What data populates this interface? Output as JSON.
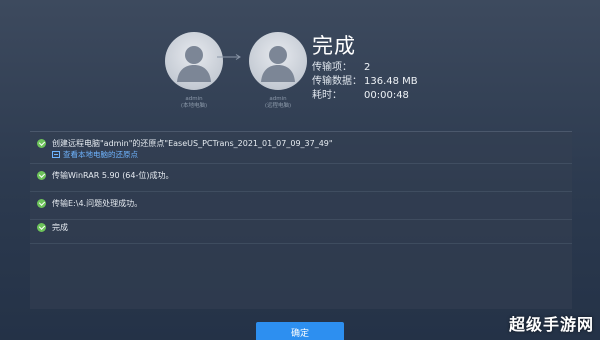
{
  "local_pc": {
    "user": "admin",
    "role": "(本地电脑)"
  },
  "remote_pc": {
    "user": "admin",
    "role": "(远程电脑)"
  },
  "status": {
    "title": "完成",
    "items_label": "传输项：",
    "items_value": "2",
    "data_label": "传输数据：",
    "data_value": "136.48 MB",
    "time_label": "耗时：",
    "time_value": "00:00:48"
  },
  "log": [
    {
      "text": "创建远程电脑\"admin\"的还原点\"EaseUS_PCTrans_2021_01_07_09_37_49\"",
      "link": "查看本地电脑的还原点"
    },
    {
      "text": "传输WinRAR 5.90 (64-位)成功。"
    },
    {
      "text": "传输E:\\4.问题处理成功。"
    },
    {
      "text": "完成"
    }
  ],
  "ok_button": "确定",
  "watermark": "超级手游网",
  "colors": {
    "accent": "#2d8ff0",
    "success": "#6dc35a",
    "link": "#6fb4ff"
  }
}
